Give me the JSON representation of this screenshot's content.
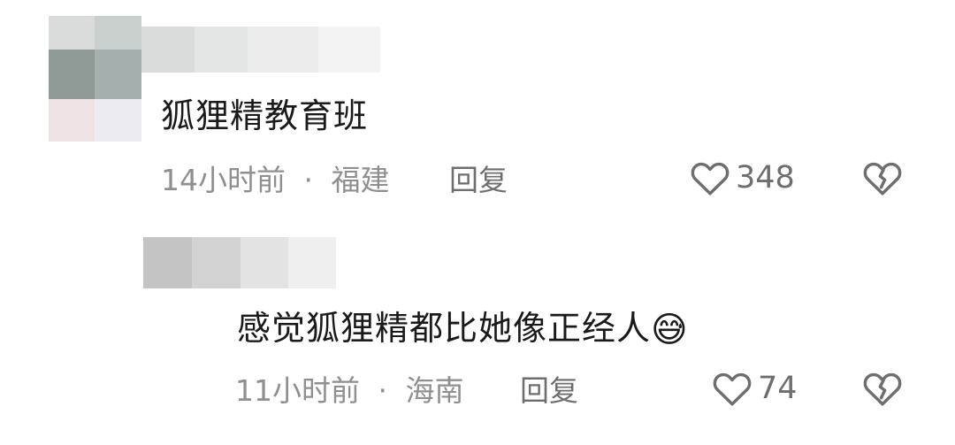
{
  "comments": [
    {
      "text": "狐狸精教育班",
      "time": "14小时前",
      "separator": "·",
      "location": "福建",
      "reply_label": "回复",
      "like_count": "348",
      "avatar_censored": true,
      "username_censored": true
    },
    {
      "text": "感觉狐狸精都比她像正经人",
      "emoji": "😅",
      "time": "11小时前",
      "separator": "·",
      "location": "海南",
      "reply_label": "回复",
      "like_count": "74",
      "avatar_censored": true,
      "username_censored": true
    }
  ],
  "icons": {
    "like": "heart-outline-icon",
    "dislike": "broken-heart-icon"
  },
  "colors": {
    "text_primary": "#1a1a1a",
    "text_secondary": "#8f8f8f",
    "icon_gray": "#6e6e6e"
  }
}
